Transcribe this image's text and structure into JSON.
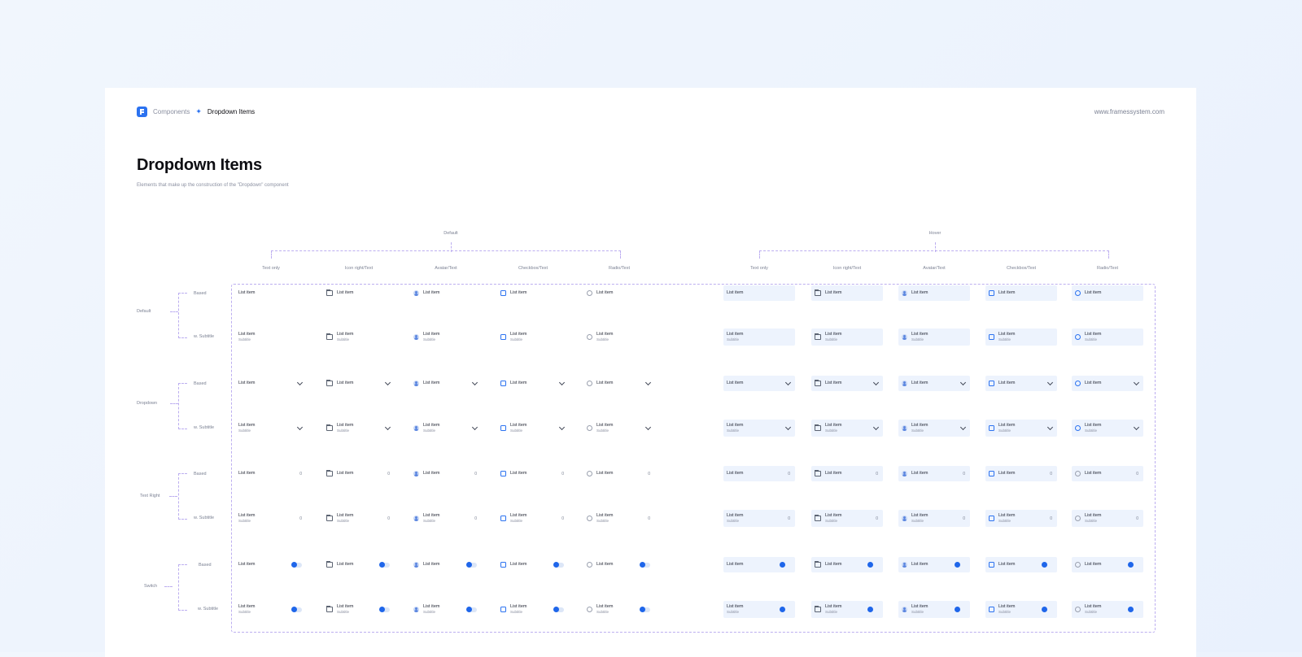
{
  "header": {
    "breadcrumb_parent": "Components",
    "breadcrumb_separator": "✦",
    "breadcrumb_current": "Dropdown Items",
    "website": "www.framessystem.com"
  },
  "page": {
    "title": "Dropdown Items",
    "subtitle": "Elements that make up the construction of the \"Dropdown\" component"
  },
  "groups": [
    "Default",
    "Hover"
  ],
  "columns": [
    "Text only",
    "Icon right/Text",
    "Avatar/Text",
    "Checkbox/Text",
    "Radio/Text"
  ],
  "row_groups": [
    {
      "name": "Default",
      "variants": [
        "Based",
        "w. Subtitle"
      ]
    },
    {
      "name": "Dropdown",
      "variants": [
        "Based",
        "w. Subtitle"
      ]
    },
    {
      "name": "Text Right",
      "variants": [
        "Based",
        "w. Subtitle"
      ]
    },
    {
      "name": "Switch",
      "variants": [
        "Based",
        "w. Subtitle"
      ]
    }
  ],
  "item": {
    "label": "List item",
    "subtitle": "Subtitle",
    "count": "0"
  },
  "colors": {
    "accent": "#1f66ea",
    "hover_bg": "#edf3fd",
    "dashed": "#bcaef0"
  },
  "icons": {
    "text_only": "none",
    "icon_right": "folder-icon",
    "avatar": "avatar-icon",
    "checkbox": "checkbox-icon",
    "radio": "radio-icon",
    "dropdown_trail": "chevron-down-icon",
    "switch_trail": "toggle-switch"
  }
}
